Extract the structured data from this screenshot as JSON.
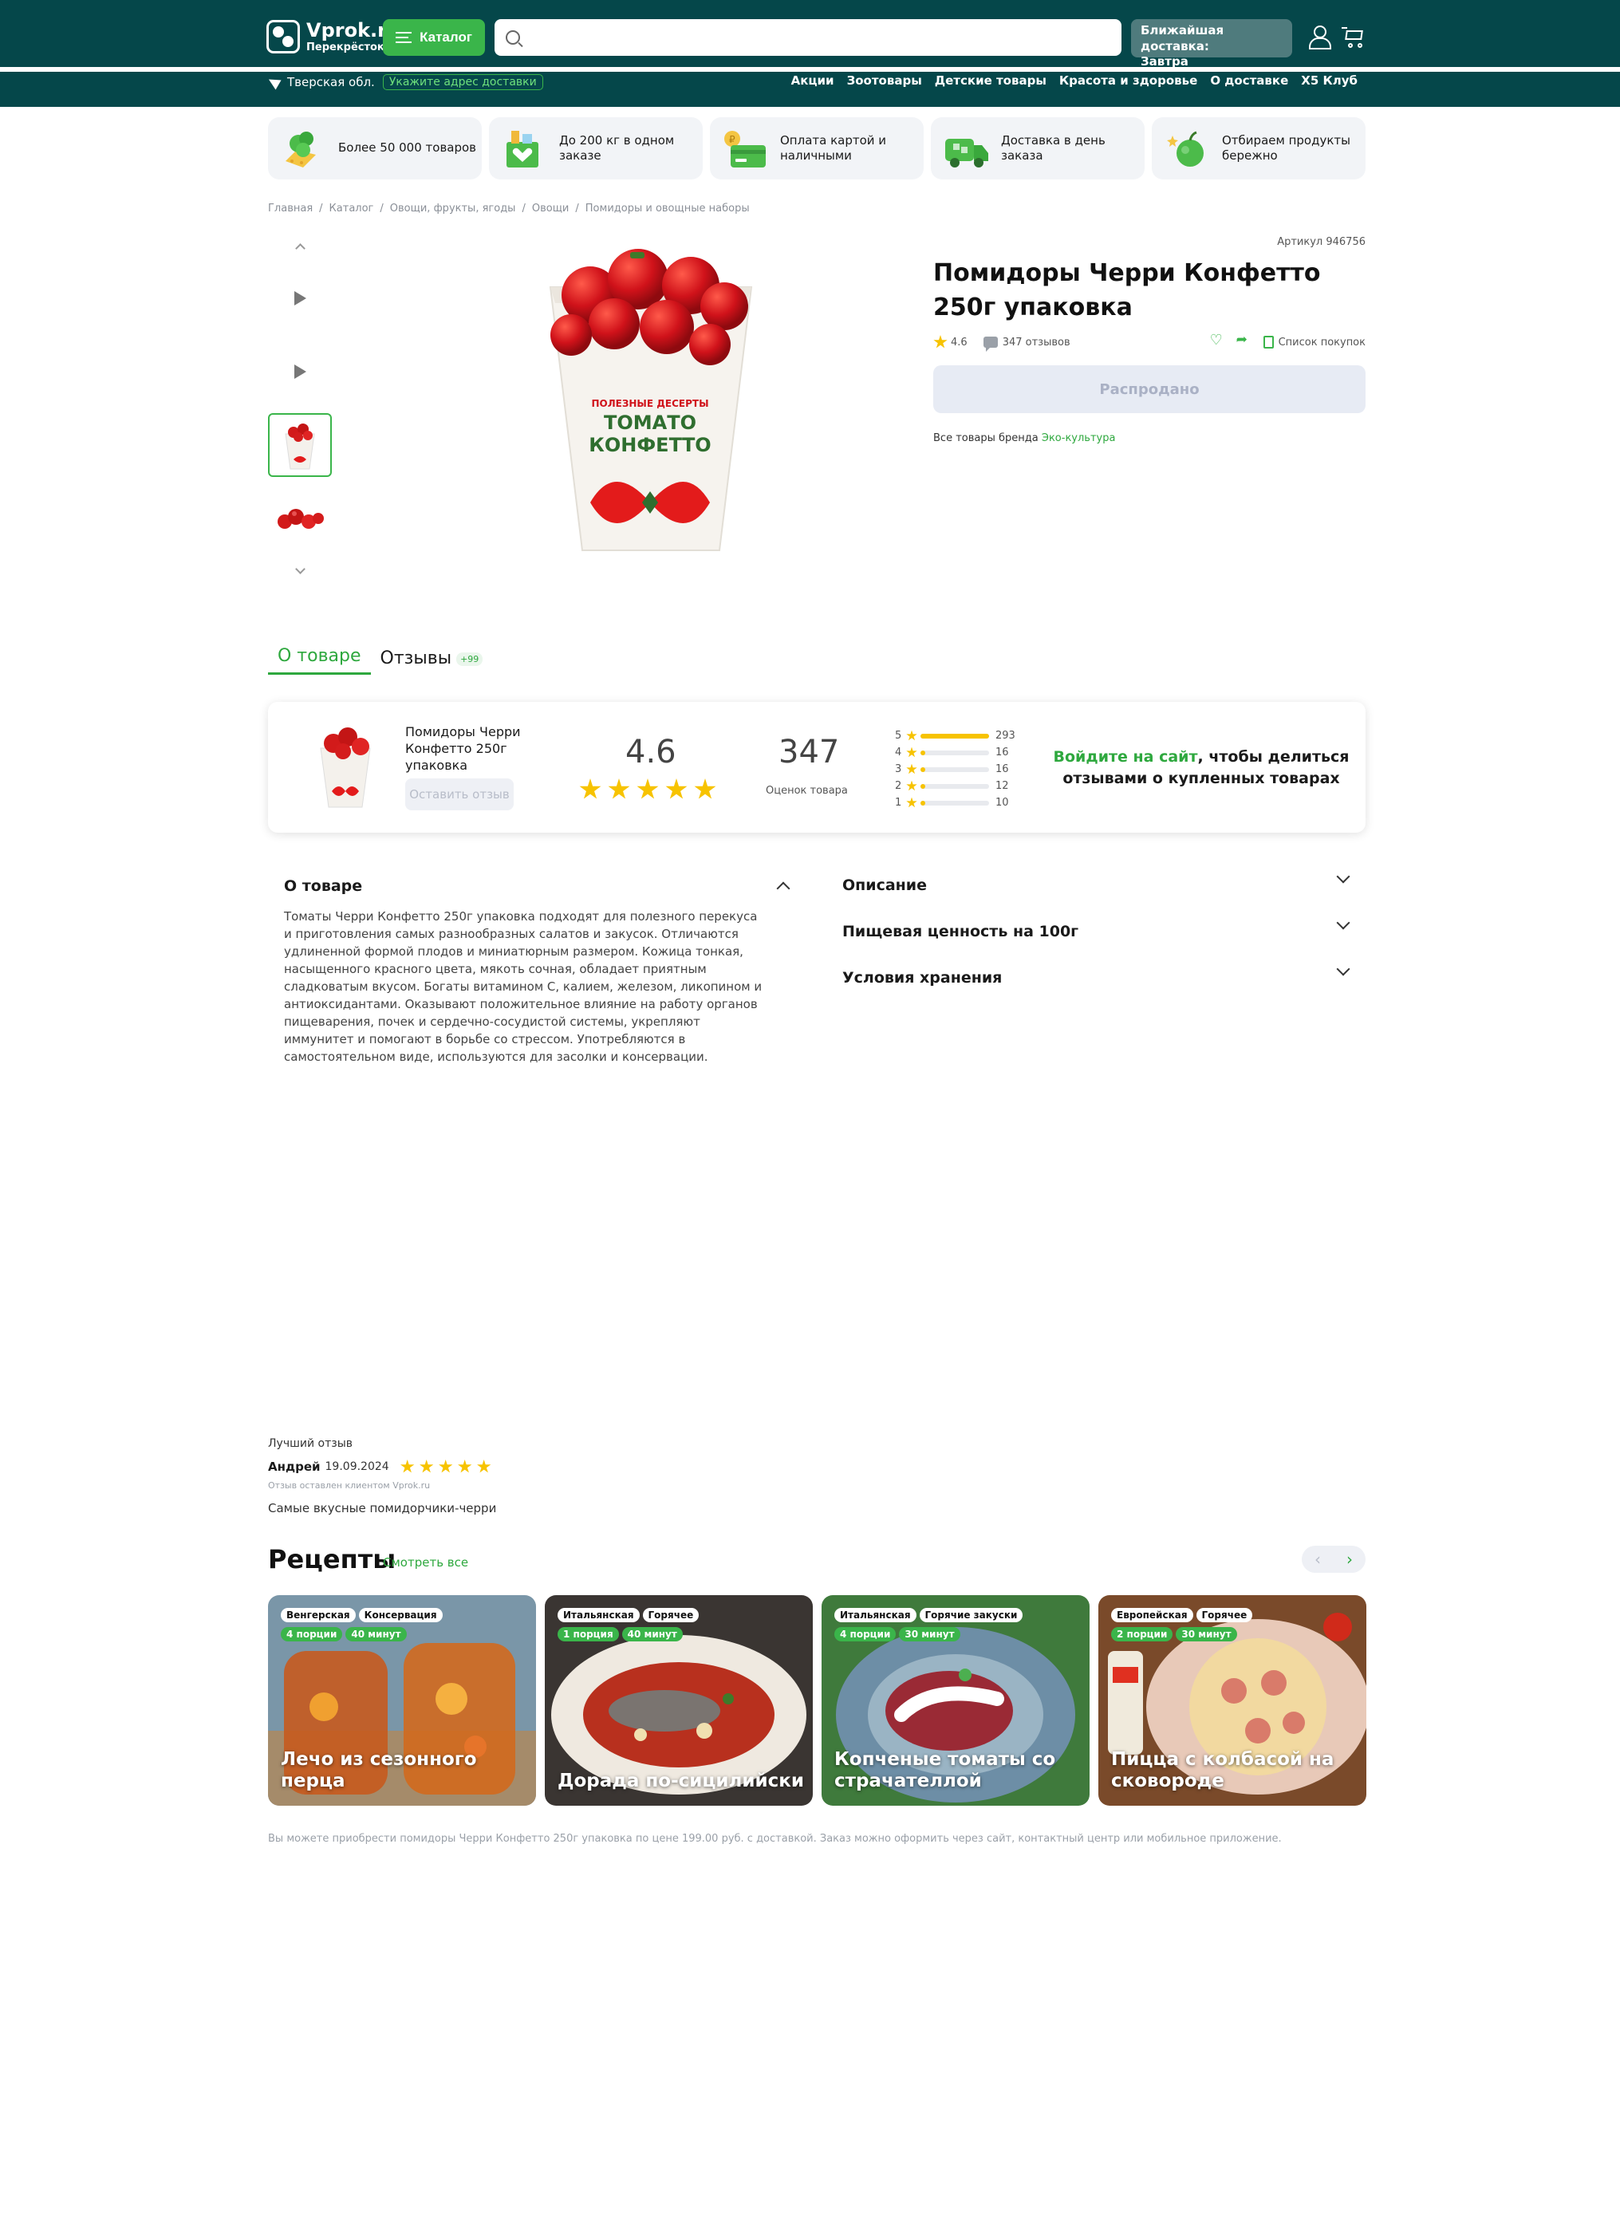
{
  "header": {
    "logo_main": "Vprok.ru",
    "logo_sub": "Перекрёсток",
    "catalog_label": "Каталог",
    "search_placeholder": "",
    "delivery_line1": "Ближайшая доставка:",
    "delivery_line2": "Завтра",
    "region": "Тверская обл.",
    "address_link": "Укажите адрес доставки",
    "nav": [
      "Акции",
      "Зоотовары",
      "Детские товары",
      "Красота и здоровье",
      "О доставке",
      "X5 Клуб"
    ]
  },
  "advantages": [
    {
      "text": "Более 50 000 товаров",
      "icon": "groceries-icon"
    },
    {
      "text": "До 200 кг в одном заказе",
      "icon": "box-icon"
    },
    {
      "text": "Оплата картой и наличными",
      "icon": "card-icon"
    },
    {
      "text": "Доставка в день заказа",
      "icon": "truck-icon"
    },
    {
      "text": "Отбираем продукты бережно",
      "icon": "apple-icon"
    }
  ],
  "breadcrumbs": [
    "Главная",
    "Каталог",
    "Овощи, фрукты, ягоды",
    "Овощи",
    "Помидоры и овощные наборы"
  ],
  "product": {
    "article": "Артикул 946756",
    "title": "Помидоры Черри Конфетто 250г упаковка",
    "rating": "4.6",
    "reviews_count": "347 отзывов",
    "shopping_list": "Список покупок",
    "soldout_label": "Распродано",
    "brand_prefix": "Все товары бренда",
    "brand": "Эко-культура",
    "pack_line1": "ПОЛЕЗНЫЕ ДЕСЕРТЫ",
    "pack_line2": "ТОМАТО",
    "pack_line3": "КОНФЕТТО"
  },
  "tabs": {
    "about": "О товаре",
    "reviews": "Отзывы",
    "reviews_badge": "+99"
  },
  "review_summary": {
    "product_name": "Помидоры Черри Конфетто 250г упаковка",
    "leave_label": "Оставить отзыв",
    "average": "4.6",
    "count": "347",
    "count_label": "Оценок товара",
    "distribution": [
      {
        "stars": "5",
        "count": 293
      },
      {
        "stars": "4",
        "count": 16
      },
      {
        "stars": "3",
        "count": 16
      },
      {
        "stars": "2",
        "count": 12
      },
      {
        "stars": "1",
        "count": 10
      }
    ],
    "cta_link": "Войдите на сайт",
    "cta_rest": ", чтобы делиться отзывами о купленных товарах"
  },
  "accordion": {
    "about_title": "О товаре",
    "about_text": "Томаты Черри Конфетто 250г упаковка подходят для полезного перекуса и приготовления самых разнообразных салатов и закусок. Отличаются удлиненной формой плодов и миниатюрным размером. Кожица тонкая, насыщенного красного цвета, мякоть сочная, обладает приятным сладковатым вкусом. Богаты витамином С, калием, железом, ликопином и антиоксидантами. Оказывают положительное влияние на работу органов пищеварения, почек и сердечно-сосудистой системы, укрепляют иммунитет и помогают в борьбе со стрессом. Употребляются в самостоятельном виде, используются для засолки и консервации.",
    "right": [
      "Описание",
      "Пищевая ценность на 100г",
      "Условия хранения"
    ]
  },
  "best_review": {
    "label": "Лучший отзыв",
    "author": "Андрей",
    "date": "19.09.2024",
    "stars": 5,
    "note": "Отзыв оставлен клиентом Vprok.ru",
    "text": "Самые вкусные помидорчики-черри"
  },
  "recipes": {
    "title": "Рецепты",
    "see_all": "Смотреть все",
    "cards": [
      {
        "tags": [
          "Венгерская",
          "Консервация"
        ],
        "portions": "4 порции",
        "time": "40 минут",
        "title": "Лечо из сезонного перца"
      },
      {
        "tags": [
          "Итальянская",
          "Горячее"
        ],
        "portions": "1 порция",
        "time": "40 минут",
        "title": "Дорада по-сицилийски"
      },
      {
        "tags": [
          "Итальянская",
          "Горячие закуски"
        ],
        "portions": "4 порции",
        "time": "30 минут",
        "title": "Копченые томаты со страчателлой"
      },
      {
        "tags": [
          "Европейская",
          "Горячее"
        ],
        "portions": "2 порции",
        "time": "30 минут",
        "title": "Пицца с колбасой на сковороде"
      }
    ]
  },
  "footer_note": "Вы можете приобрести помидоры Черри Конфетто 250г упаковка по цене 199.00 руб. с доставкой. Заказ можно оформить через сайт, контактный центр или мобильное приложение.",
  "colors": {
    "brand_dark": "#05474a",
    "accent_green": "#3ab54a",
    "star_yellow": "#f7c300"
  }
}
